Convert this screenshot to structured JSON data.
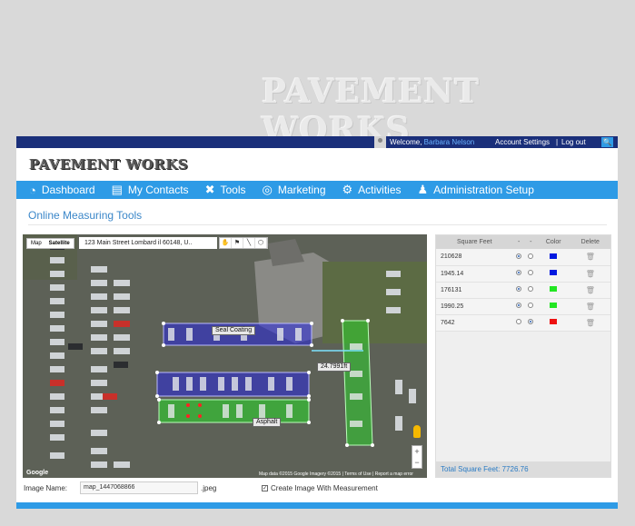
{
  "watermark": "PAVEMENT WORKS",
  "topbar": {
    "welcome": "Welcome,",
    "username": "Barbara Nelson",
    "account_settings": "Account Settings",
    "separator": "|",
    "logout": "Log out"
  },
  "logo": "PAVEMENT WORKS",
  "nav": [
    {
      "label": "Dashboard",
      "icon": "dashboard-icon"
    },
    {
      "label": "My Contacts",
      "icon": "contacts-icon"
    },
    {
      "label": "Tools",
      "icon": "tools-icon"
    },
    {
      "label": "Marketing",
      "icon": "marketing-icon"
    },
    {
      "label": "Activities",
      "icon": "gear-icon"
    },
    {
      "label": "Administration Setup",
      "icon": "admin-icon"
    }
  ],
  "page_title": "Online Measuring Tools",
  "map": {
    "type_map": "Map",
    "type_satellite": "Satellite",
    "address": "123 Main Street  Lombard  il 60148, U..",
    "labels": {
      "seal": "Seal Coating",
      "measure": "24.7991ft",
      "asphalt": "Asphalt"
    },
    "footer": "Map data ©2015 Google Imagery ©2015  |  Terms of Use  |  Report a map error",
    "google": "Google",
    "zoom_in": "+",
    "zoom_out": "−"
  },
  "table": {
    "headers": [
      "Square Feet",
      "-",
      "-",
      "Color",
      "Delete"
    ],
    "rows": [
      {
        "sqft": "210628",
        "r1": true,
        "r2": false,
        "color": "#0019e0"
      },
      {
        "sqft": "1945.14",
        "r1": true,
        "r2": false,
        "color": "#0019e0"
      },
      {
        "sqft": "176131",
        "r1": true,
        "r2": false,
        "color": "#22e622"
      },
      {
        "sqft": "1990.25",
        "r1": true,
        "r2": false,
        "color": "#22e622"
      },
      {
        "sqft": "7642",
        "r1": false,
        "r2": true,
        "color": "#ee1111"
      }
    ],
    "total_label": "Total Square Feet:",
    "total_value": "7726.76"
  },
  "image_name_label": "Image Name:",
  "image_name_value": "map_1447068866",
  "image_ext": ".jpeg",
  "create_image_label": "Create Image With Measurement",
  "create_image_checked": true
}
